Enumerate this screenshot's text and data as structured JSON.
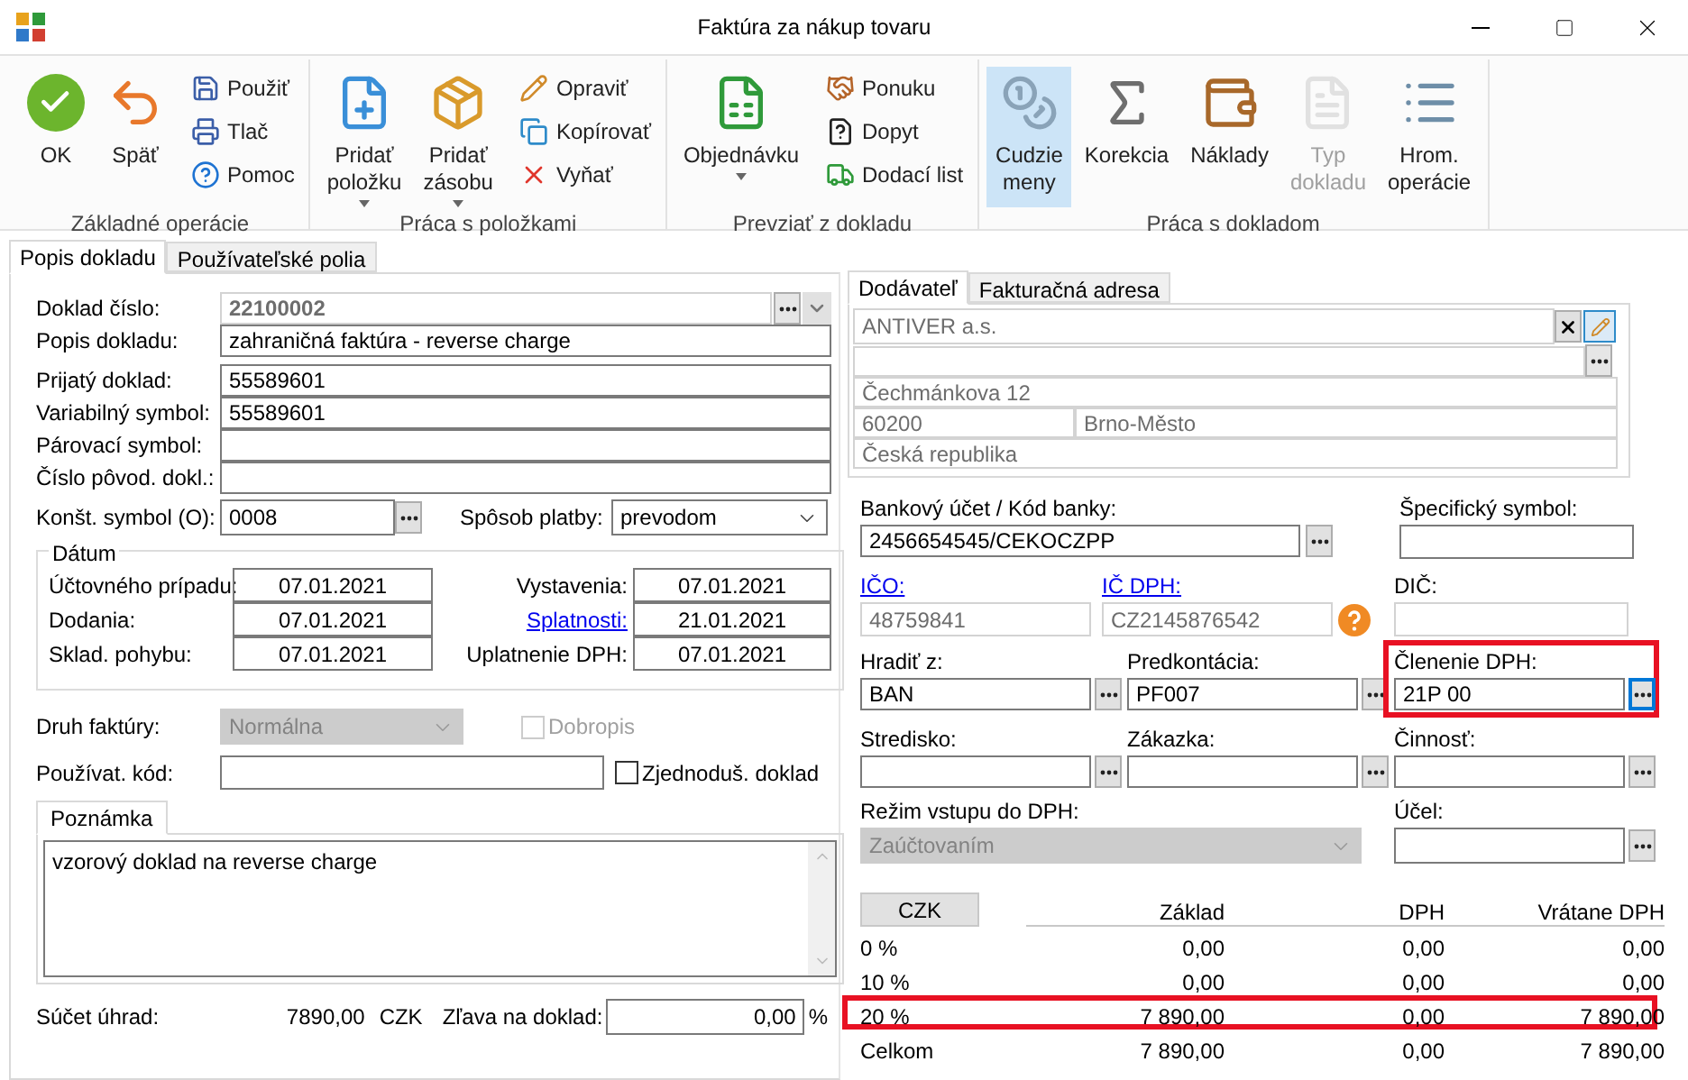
{
  "window": {
    "title": "Faktúra za nákup tovaru"
  },
  "ribbon": {
    "groups": [
      {
        "label": "Základné operácie",
        "items": [
          {
            "label": "OK",
            "kind": "large",
            "selected": false,
            "disabled": false
          },
          {
            "label": "Späť",
            "kind": "large",
            "selected": false,
            "disabled": false
          },
          {
            "label": "Použiť",
            "kind": "small",
            "selected": false,
            "disabled": false
          },
          {
            "label": "Tlač",
            "kind": "small",
            "selected": false,
            "disabled": false
          },
          {
            "label": "Pomoc",
            "kind": "small",
            "selected": false,
            "disabled": false
          }
        ]
      },
      {
        "label": "Práca s položkami",
        "items": [
          {
            "label": "Pridať\npoložku",
            "kind": "large",
            "selected": false,
            "disabled": false,
            "dropdown": true
          },
          {
            "label": "Pridať\nzásobu",
            "kind": "large",
            "selected": false,
            "disabled": false,
            "dropdown": true
          },
          {
            "label": "Opraviť",
            "kind": "small",
            "selected": false,
            "disabled": false
          },
          {
            "label": "Kopírovať",
            "kind": "small",
            "selected": false,
            "disabled": false
          },
          {
            "label": "Vyňať",
            "kind": "small",
            "selected": false,
            "disabled": false
          }
        ]
      },
      {
        "label": "Prevziať z dokladu",
        "items": [
          {
            "label": "Objednávku",
            "kind": "large",
            "selected": false,
            "disabled": false,
            "dropdown": true
          },
          {
            "label": "Ponuku",
            "kind": "small",
            "selected": false,
            "disabled": false
          },
          {
            "label": "Dopyt",
            "kind": "small",
            "selected": false,
            "disabled": false
          },
          {
            "label": "Dodací list",
            "kind": "small",
            "selected": false,
            "disabled": false
          }
        ]
      },
      {
        "label": "Práca s dokladom",
        "items": [
          {
            "label": "Cudzie\nmeny",
            "kind": "large",
            "selected": true,
            "disabled": false
          },
          {
            "label": "Korekcia",
            "kind": "large",
            "selected": false,
            "disabled": false
          },
          {
            "label": "Náklady",
            "kind": "large",
            "selected": false,
            "disabled": false
          },
          {
            "label": "Typ\ndokladu",
            "kind": "large",
            "selected": false,
            "disabled": true
          },
          {
            "label": "Hrom.\noperácie",
            "kind": "large",
            "selected": false,
            "disabled": false
          }
        ]
      }
    ]
  },
  "document_tabs": [
    {
      "label": "Popis dokladu",
      "selected": true
    },
    {
      "label": "Používateľské polia",
      "selected": false
    }
  ],
  "header_fields": [
    {
      "label": "Doklad číslo:",
      "value": "22100002",
      "kind": "number"
    },
    {
      "label": "Popis dokladu:",
      "value": "zahraničná faktúra - reverse charge",
      "kind": "text"
    },
    {
      "label": "Prijatý doklad:",
      "value": "55589601",
      "kind": "text"
    },
    {
      "label": "Variabilný symbol:",
      "value": "55589601",
      "kind": "text"
    },
    {
      "label": "Párovací symbol:",
      "kind": "text"
    },
    {
      "label": "Číslo pôvod. dokl.:",
      "kind": "text"
    }
  ],
  "constant_symbol": {
    "label": "Konšt. symbol (O):",
    "value": "0008"
  },
  "payment_method": {
    "label": "Spôsob platby:",
    "value": "prevodom"
  },
  "dates": {
    "title": "Dátum",
    "left": [
      {
        "label": "Účtovného prípadu:",
        "value": "07.01.2021"
      },
      {
        "label": "Dodania:",
        "value": "07.01.2021"
      },
      {
        "label": "Sklad. pohybu:",
        "value": "07.01.2021"
      }
    ],
    "right": [
      {
        "label": "Vystavenia:",
        "value": "07.01.2021",
        "link": false
      },
      {
        "label": "Splatnosti:",
        "value": "21.01.2021",
        "link": true
      },
      {
        "label": "Uplatnenie DPH:",
        "value": "07.01.2021",
        "link": false
      }
    ]
  },
  "invoice_type": {
    "label": "Druh faktúry:",
    "value": "Normálna",
    "disabled": true
  },
  "credit_note": {
    "label": "Dobropis",
    "checked": false,
    "disabled": true
  },
  "user_code": {
    "label": "Používat. kód:"
  },
  "simplified": {
    "label": "Zjednoduš. doklad",
    "checked": false,
    "disabled": false
  },
  "note": {
    "tab": "Poznámka",
    "text": "vzorový doklad na reverse charge"
  },
  "payments_sum": {
    "label": "Súčet úhrad:",
    "value": "7890,00",
    "currency": "CZK"
  },
  "discount": {
    "label": "Zľava na doklad:",
    "value": "0,00",
    "unit": "%"
  },
  "partner_tabs": [
    {
      "label": "Dodávateľ",
      "selected": true
    },
    {
      "label": "Fakturačná adresa",
      "selected": false
    }
  ],
  "partner": {
    "name": "ANTIVER a.s.",
    "street": "Čechmánkova 12",
    "zip": "60200",
    "city": "Brno-Město",
    "country": "Česká republika"
  },
  "bank_account": {
    "label": "Bankový účet / Kód banky:",
    "value": "2456654545/CEKOCZPP"
  },
  "specific_symbol": {
    "label": "Špecifický symbol:"
  },
  "ids": [
    {
      "label": "IČO:",
      "value": "48759841",
      "link": true
    },
    {
      "label": "IČ DPH:",
      "value": "CZ2145876542",
      "link": true
    },
    {
      "label": "DIČ:",
      "link": false
    }
  ],
  "lookups": [
    {
      "label": "Hradiť z:",
      "value": "BAN",
      "highlighted": false,
      "focused": false
    },
    {
      "label": "Predkontácia:",
      "value": "PF007",
      "highlighted": false,
      "focused": false
    },
    {
      "label": "Členenie DPH:",
      "value": "21P 00",
      "highlighted": true,
      "focused": true
    },
    {
      "label": "Stredisko:",
      "highlighted": false,
      "focused": false
    },
    {
      "label": "Zákazka:",
      "highlighted": false,
      "focused": false
    },
    {
      "label": "Činnosť:",
      "highlighted": false,
      "focused": false
    }
  ],
  "vat_mode": {
    "label": "Režim vstupu do DPH:",
    "value": "Zaúčtovaním",
    "disabled": true
  },
  "purpose": {
    "label": "Účel:"
  },
  "vat_table": {
    "columns": [
      "CZK",
      "Základ",
      "DPH",
      "Vrátane DPH"
    ],
    "rows": [
      {
        "cells": [
          "0 %",
          "0,00",
          "0,00",
          "0,00"
        ],
        "highlighted": false
      },
      {
        "cells": [
          "10 %",
          "0,00",
          "0,00",
          "0,00"
        ],
        "highlighted": false
      },
      {
        "cells": [
          "20 %",
          "7 890,00",
          "0,00",
          "7 890,00"
        ],
        "highlighted": true
      },
      {
        "cells": [
          "Celkom",
          "7 890,00",
          "0,00",
          "7 890,00"
        ],
        "highlighted": false
      }
    ]
  }
}
